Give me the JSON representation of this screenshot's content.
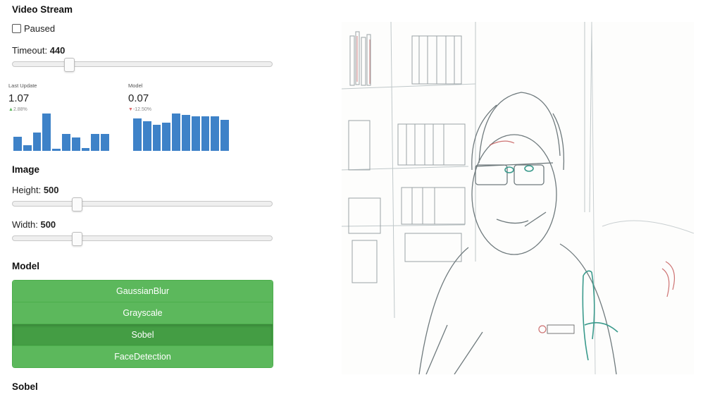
{
  "video_stream": {
    "title": "Video Stream",
    "paused_label": "Paused",
    "paused": false,
    "timeout_label": "Timeout:",
    "timeout_value": "440",
    "timeout_fraction": 0.22
  },
  "stats": {
    "last_update": {
      "label": "Last Update",
      "value": "1.07",
      "delta": "2.88%",
      "direction": "up",
      "delta_color": "#5cb85c",
      "bars": [
        3,
        1.2,
        3.8,
        7.8,
        0.4,
        3.5,
        2.8,
        0.6,
        3.6,
        3.5
      ]
    },
    "model": {
      "label": "Model",
      "value": "0.07",
      "delta": "-12.50%",
      "direction": "down",
      "delta_color": "#e06c6c",
      "bars": [
        6.8,
        6.2,
        5.5,
        5.9,
        7.8,
        7.5,
        7.2,
        7.2,
        7.2,
        6.5
      ]
    },
    "bar_color": "#3e82c8"
  },
  "image": {
    "title": "Image",
    "height_label": "Height:",
    "height_value": "500",
    "height_fraction": 0.25,
    "width_label": "Width:",
    "width_value": "500",
    "width_fraction": 0.25
  },
  "model": {
    "title": "Model",
    "options": [
      "GaussianBlur",
      "Grayscale",
      "Sobel",
      "FaceDetection"
    ],
    "selected": "Sobel",
    "button_color": "#5cb85c",
    "active_color": "#449d44"
  },
  "footer_section": {
    "title": "Sobel"
  }
}
